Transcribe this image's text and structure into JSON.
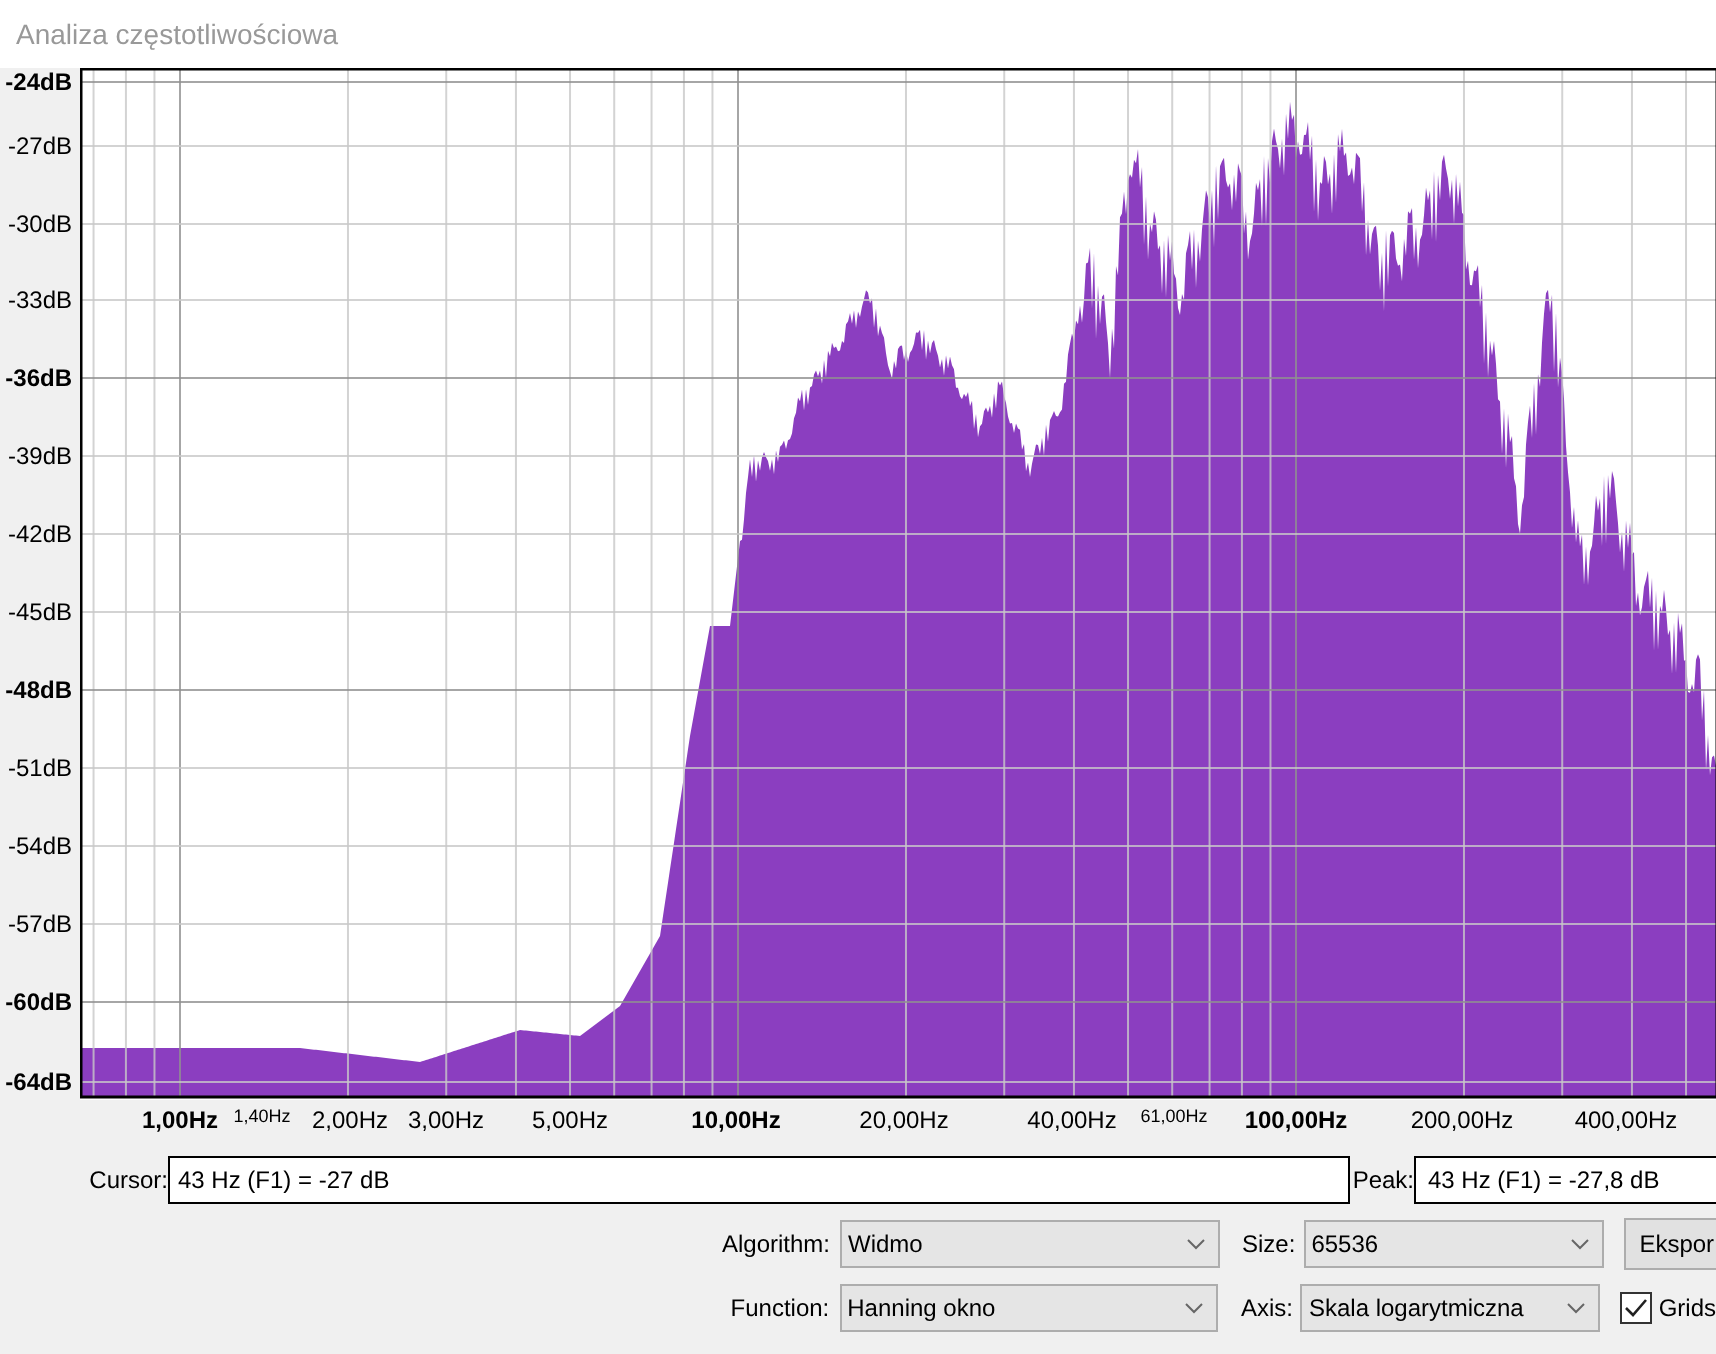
{
  "window": {
    "title": "Analiza częstotliwościowa"
  },
  "plot": {
    "y_labels": [
      {
        "text": "-24dB",
        "kind": "major"
      },
      {
        "text": "-27dB",
        "kind": "minor"
      },
      {
        "text": "-30dB",
        "kind": "minor"
      },
      {
        "text": "-33dB",
        "kind": "minor"
      },
      {
        "text": "-36dB",
        "kind": "major"
      },
      {
        "text": "-39dB",
        "kind": "minor"
      },
      {
        "text": "-42dB",
        "kind": "minor"
      },
      {
        "text": "-45dB",
        "kind": "minor"
      },
      {
        "text": "-48dB",
        "kind": "major"
      },
      {
        "text": "-51dB",
        "kind": "minor"
      },
      {
        "text": "-54dB",
        "kind": "minor"
      },
      {
        "text": "-57dB",
        "kind": "minor"
      },
      {
        "text": "-60dB",
        "kind": "major"
      },
      {
        "text": "-64dB",
        "kind": "major"
      }
    ],
    "x_labels": [
      {
        "text": "1,00Hz",
        "kind": "major"
      },
      {
        "text": "1,40Hz",
        "kind": "small"
      },
      {
        "text": "2,00Hz",
        "kind": "minor"
      },
      {
        "text": "3,00Hz",
        "kind": "minor"
      },
      {
        "text": "5,00Hz",
        "kind": "minor"
      },
      {
        "text": "10,00Hz",
        "kind": "major"
      },
      {
        "text": "20,00Hz",
        "kind": "minor"
      },
      {
        "text": "40,00Hz",
        "kind": "minor"
      },
      {
        "text": "61,00Hz",
        "kind": "small"
      },
      {
        "text": "100,00Hz",
        "kind": "major"
      },
      {
        "text": "200,00Hz",
        "kind": "minor"
      },
      {
        "text": "400,00Hz",
        "kind": "minor"
      }
    ]
  },
  "cursor": {
    "label": "Cursor:",
    "value": "43 Hz (F1) = -27 dB"
  },
  "peak": {
    "label": "Peak:",
    "value": "43 Hz (F1) = -27,8 dB"
  },
  "controls": [
    {
      "label": "Algorithm:",
      "value": "Widmo"
    },
    {
      "label": "Size:",
      "value": "65536"
    },
    {
      "label": "Function:",
      "value": "Hanning okno"
    },
    {
      "label": "Axis:",
      "value": "Skala logarytmiczna"
    }
  ],
  "export_button": "Ekspor",
  "grids": {
    "label": "Grids",
    "checked": true
  }
}
